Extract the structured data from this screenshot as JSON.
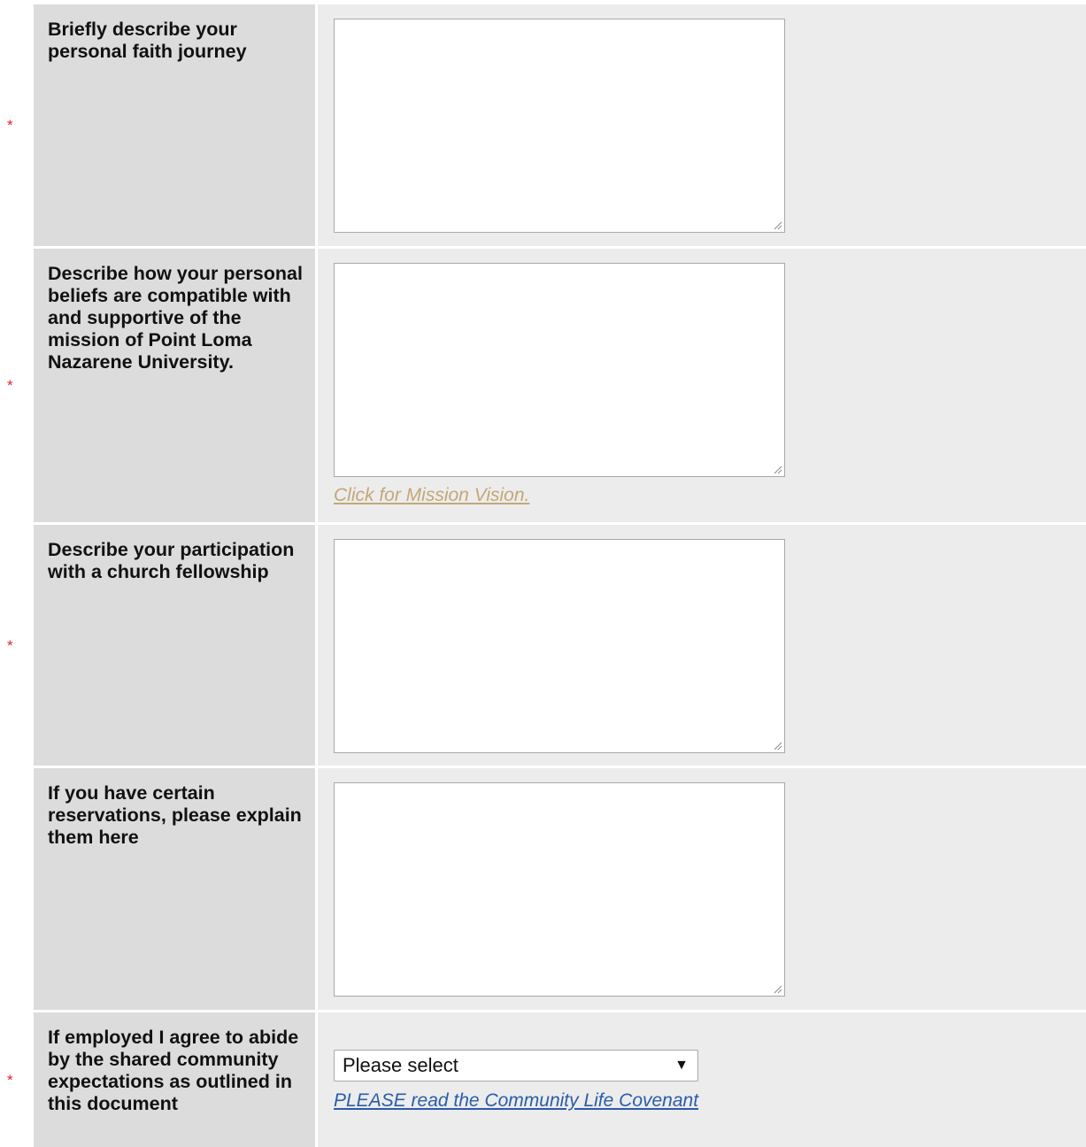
{
  "required_marker": "*",
  "questions": [
    {
      "label": "Briefly describe your personal faith journey",
      "required": true,
      "type": "textarea",
      "value": ""
    },
    {
      "label": "Describe how your personal beliefs are compatible with and supportive of the mission of Point Loma Nazarene University.",
      "required": true,
      "type": "textarea",
      "value": "",
      "link": "Click for Mission Vision."
    },
    {
      "label": "Describe your participation with a church fellowship",
      "required": true,
      "type": "textarea",
      "value": ""
    },
    {
      "label": "If you have certain reservations, please explain them here",
      "required": false,
      "type": "textarea",
      "value": ""
    },
    {
      "label": "If employed I agree to abide by the shared community expectations as outlined in this document",
      "required": true,
      "type": "select",
      "selected": "Please select",
      "link": "PLEASE read the Community Life Covenant"
    }
  ],
  "colors": {
    "label_bg": "#dcdcdc",
    "input_bg": "#ececec",
    "required": "#e0212a",
    "mission_link": "#c3a875",
    "covenant_link": "#2a5caa"
  }
}
